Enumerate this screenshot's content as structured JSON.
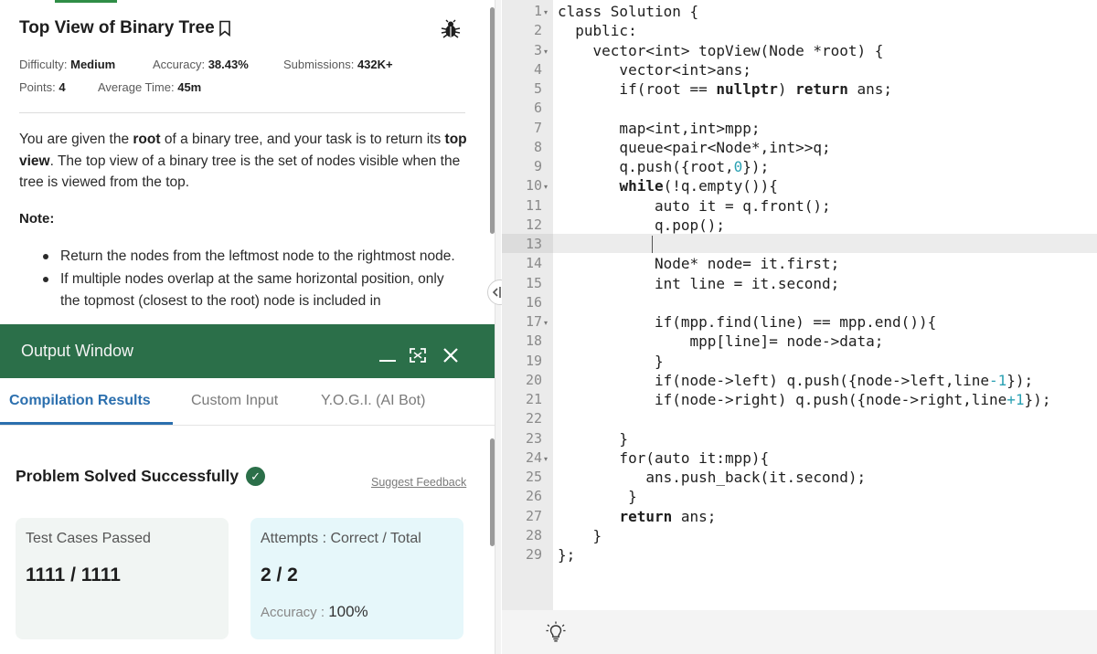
{
  "problem": {
    "title": "Top View of Binary Tree",
    "difficulty_label": "Difficulty:",
    "difficulty": "Medium",
    "accuracy_label": "Accuracy:",
    "accuracy": "38.43%",
    "submissions_label": "Submissions:",
    "submissions": "432K+",
    "points_label": "Points:",
    "points": "4",
    "avg_time_label": "Average Time:",
    "avg_time": "45m",
    "desc": {
      "p1": "You are given the ",
      "b1": "root",
      "p2": " of a binary tree, and your task is to return its ",
      "b2": "top view",
      "p3": ". The top view of a binary tree is the set of nodes visible when the tree is viewed from the top."
    },
    "note_label": "Note:",
    "bullets": [
      "Return the nodes from the leftmost node to the rightmost node.",
      "If multiple nodes overlap at the same horizontal position, only the topmost (closest to the root) node is included in"
    ]
  },
  "output": {
    "title": "Output Window",
    "tabs": [
      "Compilation Results",
      "Custom Input",
      "Y.O.G.I. (AI Bot)"
    ],
    "solved_text": "Problem Solved Successfully",
    "feedback": "Suggest Feedback",
    "test_label": "Test Cases Passed",
    "test_value": "1111 / 1111",
    "attempts_label": "Attempts : Correct / Total",
    "attempts_value": "2 / 2",
    "accuracy_label": "Accuracy : ",
    "accuracy_value": "100%"
  },
  "editor": {
    "line_numbers": [
      "1",
      "2",
      "3",
      "4",
      "5",
      "6",
      "7",
      "8",
      "9",
      "10",
      "11",
      "12",
      "13",
      "14",
      "15",
      "16",
      "17",
      "18",
      "19",
      "20",
      "21",
      "22",
      "23",
      "24",
      "25",
      "26",
      "27",
      "28",
      "29"
    ],
    "lines": [
      "class Solution {",
      "  public:",
      "    vector<int> topView(Node *root) {",
      "       vector<int>ans;",
      "       if(root == nullptr) return ans;",
      "",
      "       map<int,int>mpp;",
      "       queue<pair<Node*,int>>q;",
      "       q.push({root,0});",
      "       while(!q.empty()){",
      "           auto it = q.front();",
      "           q.pop();",
      "",
      "           Node* node= it.first;",
      "           int line = it.second;",
      "",
      "           if(mpp.find(line) == mpp.end()){",
      "               mpp[line]= node->data;",
      "           }",
      "           if(node->left) q.push({node->left,line-1});",
      "           if(node->right) q.push({node->right,line+1});",
      "",
      "       }",
      "       for(auto it:mpp){",
      "          ans.push_back(it.second);",
      "        }",
      "       return ans;",
      "    }",
      "};"
    ]
  },
  "colors": {
    "brand_green": "#2b6f49",
    "tab_blue": "#2b6fae",
    "number_cyan": "#2aa1b3"
  },
  "icons": [
    "bookmark-icon",
    "bug-icon",
    "minimize-icon",
    "expand-icon",
    "close-icon",
    "check-circle-icon",
    "split-handle-icon",
    "lightbulb-icon"
  ]
}
